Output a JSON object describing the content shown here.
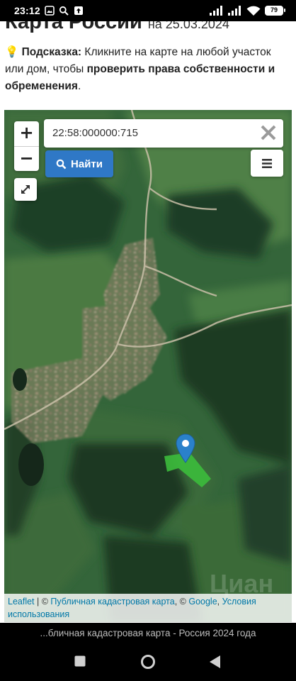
{
  "status_bar": {
    "time": "23:12",
    "battery": "79",
    "icons": [
      "gallery-icon",
      "search-icon",
      "upload-icon",
      "signal-icon",
      "signal-icon",
      "wifi-icon",
      "battery-icon"
    ]
  },
  "header": {
    "title": "Карта России",
    "date": "на 25.03.2024"
  },
  "hint": {
    "icon": "lightbulb-icon",
    "label": "Подсказка:",
    "text_before": "Кликните на карте на любой участок или дом, чтобы",
    "bold_text": "проверить права собственности и обременения",
    "text_after": "."
  },
  "map": {
    "zoom_in": "+",
    "zoom_out": "−",
    "search": {
      "value": "22:58:000000:715"
    },
    "find_button": "Найти",
    "attribution": {
      "leaflet": "Leaflet",
      "separator1": " | © ",
      "cadastral": "Публичная кадастровая карта",
      "separator2": ", © ",
      "google": "Google",
      "separator3": ", ",
      "terms": "Условия использования"
    },
    "colors": {
      "parcel": "#3cbd3c",
      "marker": "#2a81cb",
      "button": "#2f78c6"
    }
  },
  "caption": "...бличная кадастровая карта - Россия 2024 года"
}
